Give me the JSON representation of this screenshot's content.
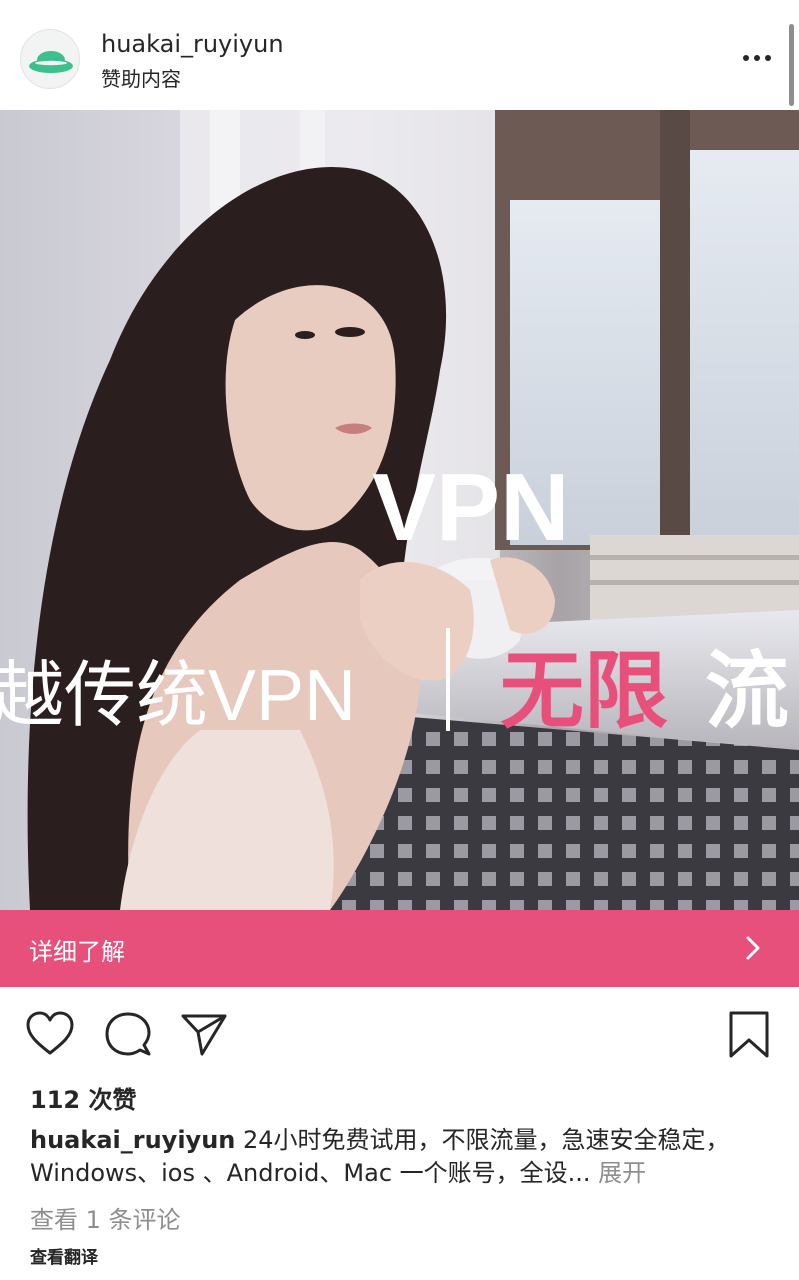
{
  "post": {
    "username": "huakai_ruyiyun",
    "sponsored_label": "赞助内容"
  },
  "ad_image": {
    "headline": "VPN",
    "banner_left": "越传统VPN",
    "banner_right_accent": "无限",
    "banner_right_rest": "流",
    "accent_color": "#e8507c"
  },
  "cta": {
    "label": "详细了解"
  },
  "actions": {
    "like_icon": "heart-icon",
    "comment_icon": "comment-icon",
    "share_icon": "send-icon",
    "save_icon": "bookmark-icon"
  },
  "likes": "112 次赞",
  "caption": {
    "user": "huakai_ruyiyun",
    "text": " 24小时免费试用，不限流量，急速安全稳定，Windows、ios 、Android、Mac 一个账号，全设... ",
    "more": "展开"
  },
  "comments_link": "查看 1 条评论",
  "translate_link": "查看翻译"
}
